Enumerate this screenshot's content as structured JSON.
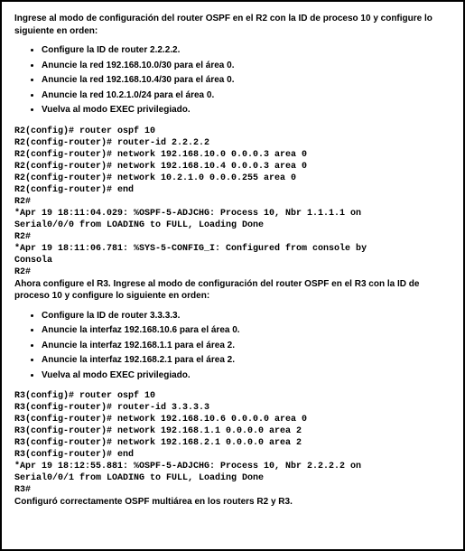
{
  "intro_r2": "Ingrese al modo de configuración del router OSPF en el R2 con la ID de proceso 10 y configure lo siguiente en orden:",
  "bullets_r2": {
    "b0": "Configure la ID de router 2.2.2.2.",
    "b1": "Anuncie la red 192.168.10.0/30 para el área 0.",
    "b2": "Anuncie la red 192.168.10.4/30 para el área 0.",
    "b3": "Anuncie la red 10.2.1.0/24 para el área 0.",
    "b4": "Vuelva al modo EXEC privilegiado."
  },
  "terminal_r2": "R2(config)# router ospf 10\nR2(config-router)# router-id 2.2.2.2\nR2(config-router)# network 192.168.10.0 0.0.0.3 area 0\nR2(config-router)# network 192.168.10.4 0.0.0.3 area 0\nR2(config-router)# network 10.2.1.0 0.0.0.255 area 0\nR2(config-router)# end\nR2#\n*Apr 19 18:11:04.029: %OSPF-5-ADJCHG: Process 10, Nbr 1.1.1.1 on\nSerial0/0/0 from LOADING to FULL, Loading Done\nR2#\n*Apr 19 18:11:06.781: %SYS-5-CONFIG_I: Configured from console by\nConsola\nR2#",
  "intro_r3": "Ahora configure el R3. Ingrese al modo de configuración del router OSPF en el R3 con la ID de proceso 10 y configure lo siguiente en orden:",
  "bullets_r3": {
    "b0": "Configure la ID de router 3.3.3.3.",
    "b1": "Anuncie la interfaz 192.168.10.6 para el área 0.",
    "b2": "Anuncie la interfaz 192.168.1.1 para el área 2.",
    "b3": "Anuncie la interfaz 192.168.2.1 para el área 2.",
    "b4": "Vuelva al modo EXEC privilegiado."
  },
  "terminal_r3": "R3(config)# router ospf 10\nR3(config-router)# router-id 3.3.3.3\nR3(config-router)# network 192.168.10.6 0.0.0.0 area 0\nR3(config-router)# network 192.168.1.1 0.0.0.0 area 2\nR3(config-router)# network 192.168.2.1 0.0.0.0 area 2\nR3(config-router)# end\n*Apr 19 18:12:55.881: %OSPF-5-ADJCHG: Process 10, Nbr 2.2.2.2 on\nSerial0/0/1 from LOADING to FULL, Loading Done\nR3#",
  "closing": "Configuró correctamente OSPF multiárea en los routers R2 y R3."
}
